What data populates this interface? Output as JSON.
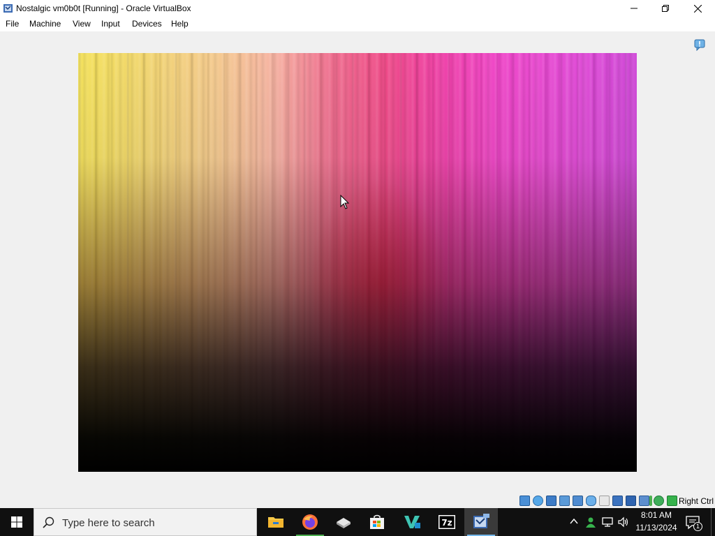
{
  "window": {
    "title": "Nostalgic vm0b0t [Running] - Oracle VirtualBox",
    "icon": "virtualbox-icon",
    "controls": [
      "minimize-icon",
      "restore-icon",
      "close-icon"
    ]
  },
  "menu": {
    "items": [
      {
        "label": "File"
      },
      {
        "label": "Machine"
      },
      {
        "label": "View"
      },
      {
        "label": "Input"
      },
      {
        "label": "Devices"
      },
      {
        "label": "Help"
      }
    ]
  },
  "vm": {
    "state": "Running",
    "wallpaper": "gradient streaks yellow-pink-magenta fading to black",
    "notification_icon": "message-icon"
  },
  "statusbar": {
    "icons": [
      "hard-disk-icon",
      "optical-drive-icon",
      "floppy-icon",
      "audio-icon",
      "network-icon",
      "usb-icon",
      "shared-folders-icon",
      "display-icon",
      "recording-icon",
      "capture-icon",
      "cpu-icon",
      "mouse-integration-icon",
      "keyboard-icon"
    ],
    "host_key": "Right Ctrl"
  },
  "taskbar": {
    "search_placeholder": "Type here to search",
    "apps": [
      {
        "name": "file-explorer-icon",
        "active": false
      },
      {
        "name": "firefox-icon",
        "active": false
      },
      {
        "name": "disk-icon",
        "active": false
      },
      {
        "name": "store-icon",
        "active": false
      },
      {
        "name": "vs-code-icon",
        "active": false
      },
      {
        "name": "7zip-icon",
        "active": false,
        "label": "7z"
      },
      {
        "name": "virtualbox-icon",
        "active": true
      }
    ],
    "tray": {
      "time": "8:01 AM",
      "date": "11/13/2024",
      "notifications": "1"
    }
  },
  "colors": {
    "accent": "#76b9ed",
    "taskbar": "#101010",
    "window_bg": "#f0f0f0"
  }
}
